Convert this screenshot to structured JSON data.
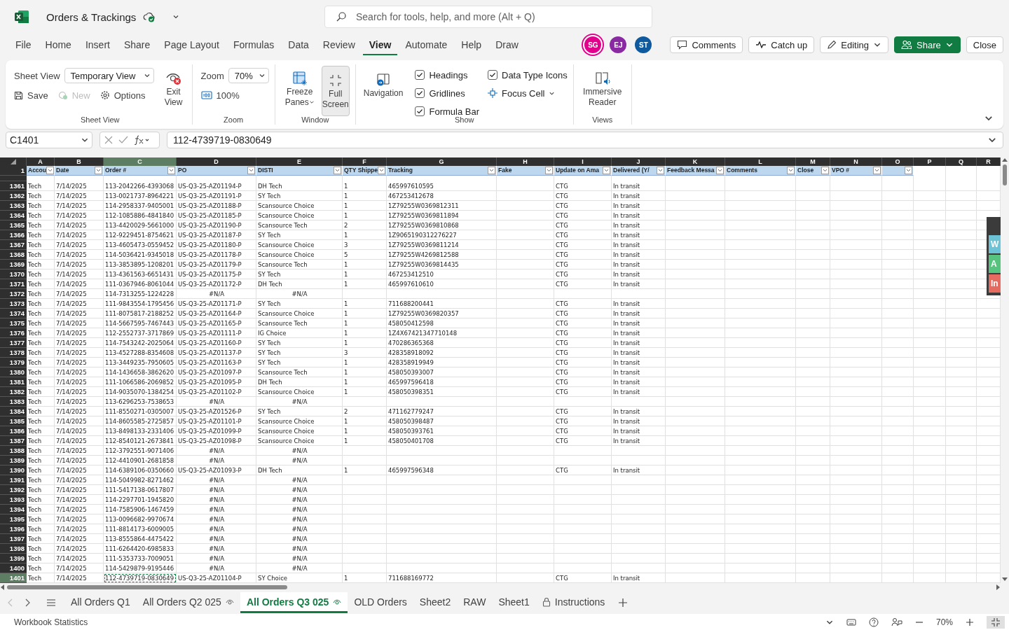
{
  "app": {
    "title": "Orders & Trackings",
    "search": {
      "placeholder": "Search for tools, help, and more (Alt + Q)"
    }
  },
  "menu_tabs": [
    {
      "label": "File",
      "selected": false
    },
    {
      "label": "Home",
      "selected": false
    },
    {
      "label": "Insert",
      "selected": false
    },
    {
      "label": "Share",
      "selected": false
    },
    {
      "label": "Page Layout",
      "selected": false
    },
    {
      "label": "Formulas",
      "selected": false
    },
    {
      "label": "Data",
      "selected": false
    },
    {
      "label": "Review",
      "selected": false
    },
    {
      "label": "View",
      "selected": true
    },
    {
      "label": "Automate",
      "selected": false
    },
    {
      "label": "Help",
      "selected": false
    },
    {
      "label": "Draw",
      "selected": false
    }
  ],
  "collaborators": [
    {
      "initials": "SG",
      "color": "#e3008c",
      "active": true
    },
    {
      "initials": "EJ",
      "color": "#8a2aa3",
      "active": false
    },
    {
      "initials": "ST",
      "color": "#0f5a9e",
      "active": false
    }
  ],
  "actions": [
    {
      "label": "Comments",
      "kind": "comments"
    },
    {
      "label": "Catch up",
      "kind": "catchup"
    },
    {
      "label": "Editing",
      "kind": "mode"
    },
    {
      "label": "Share",
      "kind": "share"
    },
    {
      "label": "Close",
      "kind": "close"
    }
  ],
  "ribbon": {
    "sheet_view": {
      "label": "Sheet View",
      "view_label": "Sheet View",
      "view_value": "Temporary View",
      "save": "Save",
      "new": {
        "label": "New",
        "disabled": true
      },
      "options": "Options",
      "exit": "Exit View"
    },
    "zoom": {
      "label": "Zoom",
      "field_label": "Zoom",
      "value": "70%",
      "reset": "100%"
    },
    "window": {
      "label": "Window",
      "freeze": "Freeze Panes",
      "full_screen": {
        "label": "Full Screen",
        "selected": true
      }
    },
    "show": {
      "label": "Show",
      "navigation": "Navigation",
      "checks": [
        {
          "label": "Headings",
          "checked": true
        },
        {
          "label": "Gridlines",
          "checked": true
        },
        {
          "label": "Formula Bar",
          "checked": true
        },
        {
          "label": "Data Type Icons",
          "checked": true
        }
      ],
      "focus_cell": "Focus Cell"
    },
    "views": {
      "label": "Views",
      "reader": "Immersive Reader"
    }
  },
  "formula_bar": {
    "name_box": "C1401",
    "formula": "112-4739719-0830649"
  },
  "sheet": {
    "columns": [
      {
        "letter": "A",
        "header": "Accou",
        "filter": true,
        "selected": false
      },
      {
        "letter": "B",
        "header": "Date",
        "filter": true,
        "selected": false
      },
      {
        "letter": "C",
        "header": "Order #",
        "filter": true,
        "selected": true
      },
      {
        "letter": "D",
        "header": "PO",
        "filter": true,
        "selected": false
      },
      {
        "letter": "E",
        "header": "DISTI",
        "filter": true,
        "selected": false
      },
      {
        "letter": "F",
        "header": "QTY Shippe",
        "filter": true,
        "selected": false
      },
      {
        "letter": "G",
        "header": "Tracking",
        "filter": true,
        "selected": false
      },
      {
        "letter": "H",
        "header": "Fake",
        "filter": true,
        "selected": false
      },
      {
        "letter": "I",
        "header": "Update on Ama",
        "filter": true,
        "selected": false
      },
      {
        "letter": "J",
        "header": "Delivered (Y/",
        "filter": true,
        "selected": false
      },
      {
        "letter": "K",
        "header": "Feedback Messa",
        "filter": true,
        "selected": false
      },
      {
        "letter": "L",
        "header": "Comments",
        "filter": true,
        "selected": false
      },
      {
        "letter": "M",
        "header": "Close",
        "filter": true,
        "selected": false
      },
      {
        "letter": "N",
        "header": "VPO #",
        "filter": true,
        "selected": false
      },
      {
        "letter": "O",
        "filter": true,
        "selected": false
      },
      {
        "letter": "P",
        "filter": false,
        "selected": false
      },
      {
        "letter": "Q",
        "filter": false,
        "selected": false
      },
      {
        "letter": "R",
        "filter": false,
        "selected": false
      }
    ],
    "header_row": "1",
    "rows": [
      {
        "number": "1361",
        "kind": "filled",
        "selected": false,
        "cells": [
          "Tech",
          "7/14/2025",
          "113-2042266-4393068",
          "US-Q3-25-AZ01194-P",
          "DH Tech",
          "1",
          "465997610595",
          null,
          "CTG",
          "In transit"
        ]
      },
      {
        "number": "1362",
        "kind": "filled",
        "selected": false,
        "cells": [
          "Tech",
          "7/14/2025",
          "113-0021737-8964221",
          "US-Q3-25-AZ01191-P",
          "SY Tech",
          "1",
          "467253412678",
          null,
          "CTG",
          "In transit"
        ]
      },
      {
        "number": "1363",
        "kind": "filled",
        "selected": false,
        "cells": [
          "Tech",
          "7/14/2025",
          "114-2958337-9405001",
          "US-Q3-25-AZ01188-P",
          "Scansource Choice",
          "1",
          "1Z79255W0369812311",
          null,
          "CTG",
          "In transit"
        ]
      },
      {
        "number": "1364",
        "kind": "filled",
        "selected": false,
        "cells": [
          "Tech",
          "7/14/2025",
          "112-1085886-4841840",
          "US-Q3-25-AZ01185-P",
          "Scansource Choice",
          "1",
          "1Z79255W0369811894",
          null,
          "CTG",
          "In transit"
        ]
      },
      {
        "number": "1365",
        "kind": "filled",
        "selected": false,
        "cells": [
          "Tech",
          "7/14/2025",
          "113-4420029-5661000",
          "US-Q3-25-AZ01190-P",
          "Scansource Tech",
          "2",
          "1Z79255W0369810868",
          null,
          "CTG",
          "In transit"
        ]
      },
      {
        "number": "1366",
        "kind": "filled",
        "selected": false,
        "cells": [
          "Tech",
          "7/14/2025",
          "112-9229451-8754621",
          "US-Q3-25-AZ01187-P",
          "SY Tech",
          "1",
          "1Z9065190312276227",
          null,
          "CTG",
          "In transit"
        ]
      },
      {
        "number": "1367",
        "kind": "filled",
        "selected": false,
        "cells": [
          "Tech",
          "7/14/2025",
          "113-4605473-0559452",
          "US-Q3-25-AZ01180-P",
          "Scansource Choice",
          "3",
          "1Z79255W0369811214",
          null,
          "CTG",
          "In transit"
        ]
      },
      {
        "number": "1368",
        "kind": "filled",
        "selected": false,
        "cells": [
          "Tech",
          "7/14/2025",
          "114-5036421-9345018",
          "US-Q3-25-AZ01178-P",
          "Scansource Choice",
          "5",
          "1Z79255W4269812588",
          null,
          "CTG",
          "In transit"
        ]
      },
      {
        "number": "1369",
        "kind": "filled",
        "selected": false,
        "cells": [
          "Tech",
          "7/14/2025",
          "113-3853895-1208201",
          "US-Q3-25-AZ01179-P",
          "Scansource Tech",
          "1",
          "1Z79255W0369814435",
          null,
          "CTG",
          "In transit"
        ]
      },
      {
        "number": "1370",
        "kind": "filled",
        "selected": false,
        "cells": [
          "Tech",
          "7/14/2025",
          "113-4361563-6651431",
          "US-Q3-25-AZ01175-P",
          "SY Tech",
          "1",
          "467253412510",
          null,
          "CTG",
          "In transit"
        ]
      },
      {
        "number": "1371",
        "kind": "filled",
        "selected": false,
        "cells": [
          "Tech",
          "7/14/2025",
          "111-0367946-8061044",
          "US-Q3-25-AZ01172-P",
          "DH Tech",
          "1",
          "465997610610",
          null,
          "CTG",
          "In transit"
        ]
      },
      {
        "number": "1372",
        "kind": "missing",
        "selected": false,
        "cells": [
          "Tech",
          "7/14/2025",
          "114-7313255-1224228",
          "#N/A",
          "#N/A"
        ]
      },
      {
        "number": "1373",
        "kind": "filled",
        "selected": false,
        "cells": [
          "Tech",
          "7/14/2025",
          "111-9843554-1795456",
          "US-Q3-25-AZ01171-P",
          "SY Tech",
          "1",
          "711688200441",
          null,
          "CTG",
          "In transit"
        ]
      },
      {
        "number": "1374",
        "kind": "filled",
        "selected": false,
        "cells": [
          "Tech",
          "7/14/2025",
          "111-8075817-2188252",
          "US-Q3-25-AZ01164-P",
          "Scansource Choice",
          "1",
          "1Z79255W0369820357",
          null,
          "CTG",
          "In transit"
        ]
      },
      {
        "number": "1375",
        "kind": "filled",
        "selected": false,
        "cells": [
          "Tech",
          "7/14/2025",
          "114-5667595-7467443",
          "US-Q3-25-AZ01165-P",
          "Scansource Tech",
          "1",
          "458050412598",
          null,
          "CTG",
          "In transit"
        ]
      },
      {
        "number": "1376",
        "kind": "filled",
        "selected": false,
        "cells": [
          "Tech",
          "7/14/2025",
          "112-2552737-3717869",
          "US-Q3-25-AZ01111-P",
          "IG Choice",
          "1",
          "1Z4X67421347710148",
          null,
          "CTG",
          "In transit"
        ]
      },
      {
        "number": "1377",
        "kind": "filled",
        "selected": false,
        "cells": [
          "Tech",
          "7/14/2025",
          "114-7543242-2025064",
          "US-Q3-25-AZ01160-P",
          "SY Tech",
          "1",
          "470286365368",
          null,
          "CTG",
          "In transit"
        ]
      },
      {
        "number": "1378",
        "kind": "filled",
        "selected": false,
        "cells": [
          "Tech",
          "7/14/2025",
          "113-4527288-8354608",
          "US-Q3-25-AZ01137-P",
          "SY Tech",
          "3",
          "428358918092",
          null,
          "CTG",
          "In transit"
        ]
      },
      {
        "number": "1379",
        "kind": "filled",
        "selected": false,
        "cells": [
          "Tech",
          "7/14/2025",
          "113-3449235-7950605",
          "US-Q3-25-AZ01163-P",
          "SY Tech",
          "1",
          "428358919949",
          null,
          "CTG",
          "In transit"
        ]
      },
      {
        "number": "1380",
        "kind": "filled",
        "selected": false,
        "cells": [
          "Tech",
          "7/14/2025",
          "114-1436658-3862620",
          "US-Q3-25-AZ01097-P",
          "Scansource Tech",
          "1",
          "458050393007",
          null,
          "CTG",
          "In transit"
        ]
      },
      {
        "number": "1381",
        "kind": "filled",
        "selected": false,
        "cells": [
          "Tech",
          "7/14/2025",
          "111-1066586-2069852",
          "US-Q3-25-AZ01095-P",
          "DH Tech",
          "1",
          "465997596418",
          null,
          "CTG",
          "In transit"
        ]
      },
      {
        "number": "1382",
        "kind": "filled",
        "selected": false,
        "cells": [
          "Tech",
          "7/14/2025",
          "114-9035070-1384254",
          "US-Q3-25-AZ01102-P",
          "Scansource Choice",
          "1",
          "458050398351",
          null,
          "CTG",
          "In transit"
        ]
      },
      {
        "number": "1383",
        "kind": "missing",
        "selected": false,
        "cells": [
          "Tech",
          "7/14/2025",
          "113-6296253-7538653",
          "#N/A",
          "#N/A"
        ]
      },
      {
        "number": "1384",
        "kind": "filled",
        "selected": false,
        "cells": [
          "Tech",
          "7/14/2025",
          "111-8550271-0305007",
          "US-Q3-25-AZ01526-P",
          "SY Tech",
          "2",
          "471162779247",
          null,
          "CTG",
          "In transit"
        ]
      },
      {
        "number": "1385",
        "kind": "filled",
        "selected": false,
        "cells": [
          "Tech",
          "7/14/2025",
          "114-8605585-2725857",
          "US-Q3-25-AZ01101-P",
          "Scansource Choice",
          "1",
          "458050398487",
          null,
          "CTG",
          "In transit"
        ]
      },
      {
        "number": "1386",
        "kind": "filled",
        "selected": false,
        "cells": [
          "Tech",
          "7/14/2025",
          "113-8498133-2331406",
          "US-Q3-25-AZ01099-P",
          "Scansource Choice",
          "1",
          "458050393761",
          null,
          "CTG",
          "In transit"
        ]
      },
      {
        "number": "1387",
        "kind": "filled",
        "selected": false,
        "cells": [
          "Tech",
          "7/14/2025",
          "112-8540121-2673841",
          "US-Q3-25-AZ01098-P",
          "Scansource Choice",
          "1",
          "458050401708",
          null,
          "CTG",
          "In transit"
        ]
      },
      {
        "number": "1388",
        "kind": "missing",
        "selected": false,
        "cells": [
          "Tech",
          "7/14/2025",
          "112-3792551-9071406",
          "#N/A",
          "#N/A"
        ]
      },
      {
        "number": "1389",
        "kind": "missing",
        "selected": false,
        "cells": [
          "Tech",
          "7/14/2025",
          "112-4410901-2681858",
          "#N/A",
          "#N/A"
        ]
      },
      {
        "number": "1390",
        "kind": "filled",
        "selected": false,
        "cells": [
          "Tech",
          "7/14/2025",
          "114-6389106-0350660",
          "US-Q3-25-AZ01093-P",
          "DH Tech",
          "1",
          "465997596348",
          null,
          "CTG",
          "In transit"
        ]
      },
      {
        "number": "1391",
        "kind": "missing",
        "selected": false,
        "cells": [
          "Tech",
          "7/14/2025",
          "114-5049982-8271462",
          "#N/A",
          "#N/A"
        ]
      },
      {
        "number": "1392",
        "kind": "missing",
        "selected": false,
        "cells": [
          "Tech",
          "7/14/2025",
          "111-5417138-0617807",
          "#N/A",
          "#N/A"
        ]
      },
      {
        "number": "1393",
        "kind": "missing",
        "selected": false,
        "cells": [
          "Tech",
          "7/14/2025",
          "114-2297701-1945820",
          "#N/A",
          "#N/A"
        ]
      },
      {
        "number": "1394",
        "kind": "missing",
        "selected": false,
        "cells": [
          "Tech",
          "7/14/2025",
          "114-7585906-1467459",
          "#N/A",
          "#N/A"
        ]
      },
      {
        "number": "1395",
        "kind": "missing",
        "selected": false,
        "cells": [
          "Tech",
          "7/14/2025",
          "113-0096682-9970674",
          "#N/A",
          "#N/A"
        ]
      },
      {
        "number": "1396",
        "kind": "missing",
        "selected": false,
        "cells": [
          "Tech",
          "7/14/2025",
          "111-8814173-6009005",
          "#N/A",
          "#N/A"
        ]
      },
      {
        "number": "1397",
        "kind": "missing",
        "selected": false,
        "cells": [
          "Tech",
          "7/14/2025",
          "113-8555864-4475422",
          "#N/A",
          "#N/A"
        ]
      },
      {
        "number": "1398",
        "kind": "missing",
        "selected": false,
        "cells": [
          "Tech",
          "7/14/2025",
          "111-6264420-6985833",
          "#N/A",
          "#N/A"
        ]
      },
      {
        "number": "1399",
        "kind": "missing",
        "selected": false,
        "cells": [
          "Tech",
          "7/14/2025",
          "111-5353733-7009051",
          "#N/A",
          "#N/A"
        ]
      },
      {
        "number": "1400",
        "kind": "missing",
        "selected": false,
        "cells": [
          "Tech",
          "7/14/2025",
          "114-5429879-9195446",
          "#N/A",
          "#N/A"
        ]
      },
      {
        "number": "1401",
        "kind": "filled",
        "selected": true,
        "cells": [
          "Tech",
          "7/14/2025",
          "112-4739719-0830649",
          "US-Q3-25-AZ01104-P",
          "SY Choice",
          "1",
          "711688169772",
          null,
          "CTG",
          "In transit"
        ]
      }
    ]
  },
  "side_panel": [
    {
      "label": "W",
      "color": "#6cc3d5"
    },
    {
      "label": "A",
      "color": "#56c47e"
    },
    {
      "label": "In",
      "color": "#e56a5f"
    }
  ],
  "sheet_tabs": [
    {
      "label": "All Orders Q1",
      "kind": "plain",
      "selected": false
    },
    {
      "label": "All Orders Q2 025",
      "kind": "watched",
      "selected": false
    },
    {
      "label": "All Orders Q3 025",
      "kind": "watched",
      "selected": true
    },
    {
      "label": "OLD Orders",
      "kind": "plain",
      "selected": false
    },
    {
      "label": "Sheet2",
      "kind": "plain",
      "selected": false
    },
    {
      "label": "RAW",
      "kind": "plain",
      "selected": false
    },
    {
      "label": "Sheet1",
      "kind": "plain",
      "selected": false
    },
    {
      "label": "Instructions",
      "kind": "locked",
      "selected": false
    }
  ],
  "status_bar": {
    "label": "Workbook Statistics",
    "zoom": "70%"
  }
}
